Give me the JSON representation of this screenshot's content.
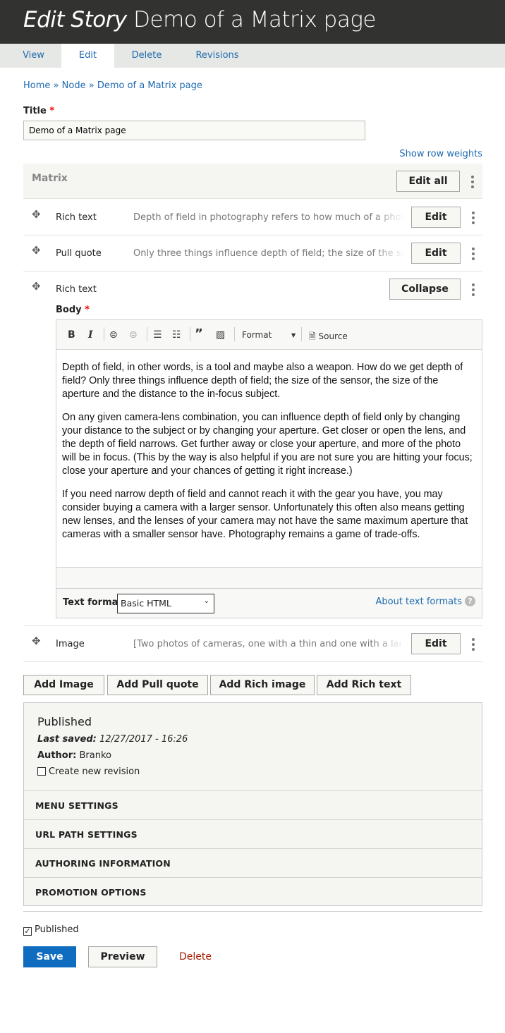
{
  "header": {
    "prefix": "Edit Story",
    "title": "Demo of a Matrix page"
  },
  "tabs": [
    {
      "label": "View"
    },
    {
      "label": "Edit",
      "active": true
    },
    {
      "label": "Delete"
    },
    {
      "label": "Revisions"
    }
  ],
  "breadcrumb": [
    "Home",
    "Node",
    "Demo of a Matrix page"
  ],
  "breadcrumb_sep": "»",
  "title_field": {
    "label": "Title",
    "required": "*",
    "value": "Demo of a Matrix page"
  },
  "show_row_weights": "Show row weights",
  "matrix": {
    "label": "Matrix",
    "edit_all": "Edit all",
    "rows": [
      {
        "type": "Rich text",
        "summary": "Depth of field in photography refers to how much of a photo is in focus.",
        "button": "Edit"
      },
      {
        "type": "Pull quote",
        "summary": "Only three things influence depth of field; the size of the sensor, the size of the aperture",
        "button": "Edit"
      },
      {
        "type": "Rich text",
        "button": "Collapse"
      },
      {
        "type": "Image",
        "summary": "[Two photos of cameras, one with a thin and one with a large depth of field]",
        "button": "Edit"
      }
    ],
    "body": {
      "label": "Body",
      "required": "*",
      "toolbar": {
        "bold": "B",
        "italic": "I",
        "format": "Format",
        "source": "Source"
      },
      "paragraphs": [
        "Depth of field, in other words, is a tool and maybe also a weapon. How do we get depth of field? Only three things influence depth of field; the size of the sensor, the size of the aperture and the distance to the in-focus subject.",
        "On any given camera-lens combination, you can influence depth of field only by changing your distance to the subject or by changing your aperture. Get closer or open the lens, and the depth of field narrows. Get further away or close your aperture, and more of the photo will be in focus. (This by the way is also helpful if you are not sure you are hitting your focus; close your aperture and your chances of getting it right increase.)",
        "If you need narrow depth of field and cannot reach it with the gear you have, you may consider buying a camera with a larger sensor. Unfortunately this often also means getting new lenses, and the lenses of your camera may not have the same maximum aperture that cameras with a smaller sensor have. Photography remains a game of trade-offs."
      ],
      "text_format_label": "Text format",
      "text_format_value": "Basic HTML",
      "about_formats": "About text formats"
    },
    "add_buttons": [
      "Add Image",
      "Add Pull quote",
      "Add Rich image",
      "Add Rich text"
    ]
  },
  "sidebar": {
    "status": "Published",
    "last_saved_label": "Last saved:",
    "last_saved": "12/27/2017 - 16:26",
    "author_label": "Author:",
    "author": "Branko",
    "new_revision": "Create new revision",
    "new_revision_checked": false,
    "sections": [
      "MENU SETTINGS",
      "URL PATH SETTINGS",
      "AUTHORING INFORMATION",
      "PROMOTION OPTIONS"
    ]
  },
  "published": {
    "label": "Published",
    "checked": true
  },
  "actions": {
    "save": "Save",
    "preview": "Preview",
    "delete": "Delete"
  },
  "colors": {
    "primary": "#0f6cbf",
    "header": "#323230",
    "delete": "#a51b00",
    "link": "#1f6ab0"
  }
}
